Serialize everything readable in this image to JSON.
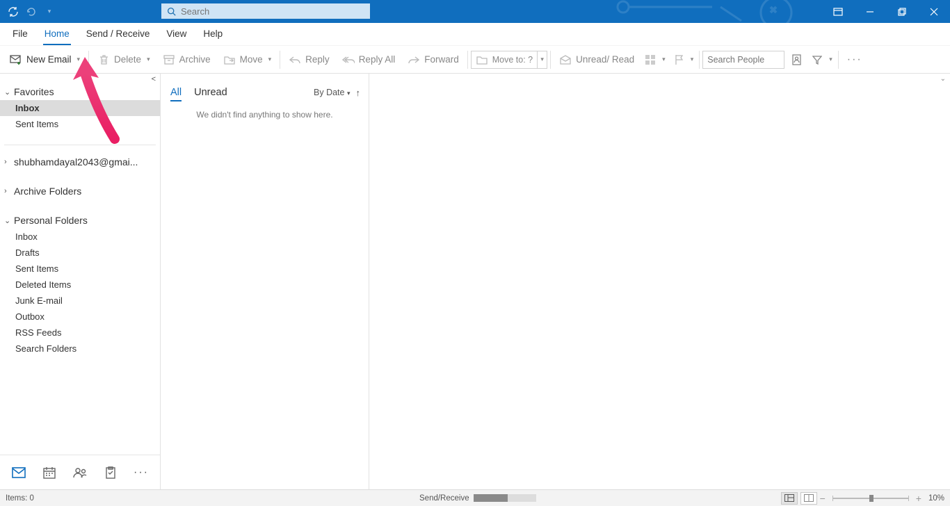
{
  "titlebar": {
    "search_placeholder": "Search"
  },
  "menu": {
    "tabs": [
      "File",
      "Home",
      "Send / Receive",
      "View",
      "Help"
    ],
    "active": 1
  },
  "ribbon": {
    "new_email": "New Email",
    "delete": "Delete",
    "archive": "Archive",
    "move": "Move",
    "reply": "Reply",
    "reply_all": "Reply All",
    "forward": "Forward",
    "move_to": "Move to: ?",
    "unread_read": "Unread/ Read",
    "search_people": "Search People"
  },
  "nav": {
    "favorites": {
      "label": "Favorites",
      "items": [
        "Inbox",
        "Sent Items"
      ]
    },
    "account": "shubhamdayal2043@gmai...",
    "archive": "Archive Folders",
    "personal": {
      "label": "Personal Folders",
      "items": [
        "Inbox",
        "Drafts",
        "Sent Items",
        "Deleted Items",
        "Junk E-mail",
        "Outbox",
        "RSS Feeds",
        "Search Folders"
      ]
    }
  },
  "list": {
    "tab_all": "All",
    "tab_unread": "Unread",
    "sort": "By Date",
    "empty": "We didn't find anything to show here."
  },
  "status": {
    "items": "Items: 0",
    "sendreceive": "Send/Receive",
    "zoom": "10%"
  }
}
